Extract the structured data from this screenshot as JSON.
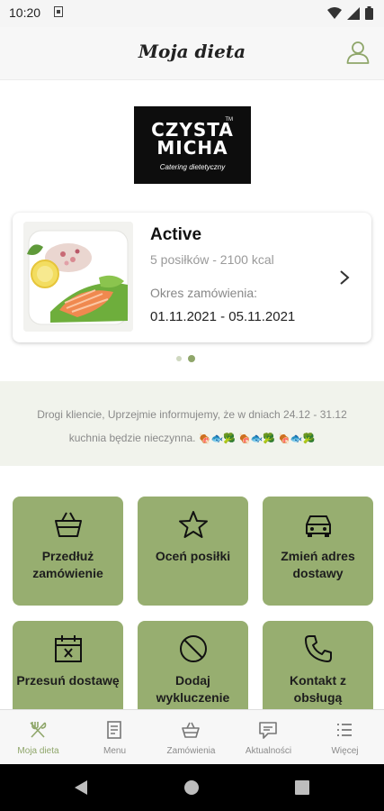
{
  "status_bar": {
    "time": "10:20"
  },
  "header": {
    "title": "Moja dieta",
    "profile_icon": "user-icon"
  },
  "brand": {
    "line1": "CZYSTA",
    "line2": "MICHA",
    "trademark": "TM",
    "tagline": "Catering dietetyczny"
  },
  "order_card": {
    "status": "Active",
    "meals_info": "5 posiłków - 2100 kcal",
    "period_label": "Okres zamówienia:",
    "period": "01.11.2021 - 05.11.2021"
  },
  "pager": {
    "count": 2,
    "active_index": 1
  },
  "notice": {
    "text": "Drogi kliencie, Uprzejmie informujemy, że w dniach 24.12 - 31.12 kuchnia będzie nieczynna.",
    "emoji": "🍖🐟🥦 🍖🐟🥦 🍖🐟🥦"
  },
  "tiles": [
    {
      "label": "Przedłuż zamówienie",
      "icon": "basket-icon"
    },
    {
      "label": "Oceń posiłki",
      "icon": "star-icon"
    },
    {
      "label": "Zmień adres dostawy",
      "icon": "car-icon"
    },
    {
      "label": "Przesuń dostawę",
      "icon": "calendar-x-icon"
    },
    {
      "label": "Dodaj wykluczenie",
      "icon": "block-icon"
    },
    {
      "label": "Kontakt z obsługą",
      "icon": "phone-icon"
    }
  ],
  "bottom_nav": [
    {
      "label": "Moja dieta",
      "icon": "cutlery-icon",
      "active": true
    },
    {
      "label": "Menu",
      "icon": "menu-doc-icon",
      "active": false
    },
    {
      "label": "Zamówienia",
      "icon": "basket-icon",
      "active": false
    },
    {
      "label": "Aktualności",
      "icon": "chat-icon",
      "active": false
    },
    {
      "label": "Więcej",
      "icon": "list-icon",
      "active": false
    }
  ],
  "colors": {
    "accent": "#97ae70",
    "accent_dark": "#8fa66a",
    "notice_bg": "#f1f3ec"
  }
}
